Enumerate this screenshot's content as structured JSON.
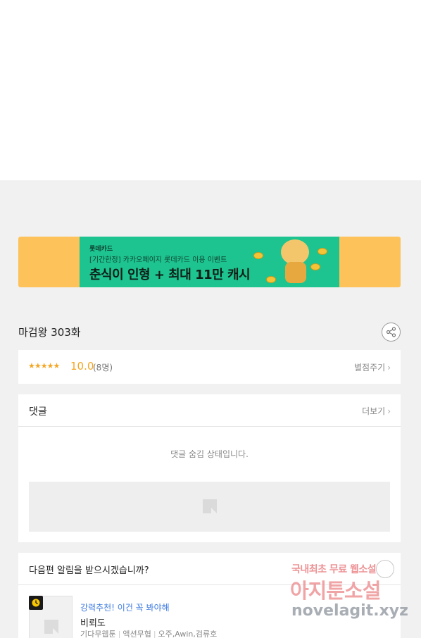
{
  "banner": {
    "brand": "롯데카드",
    "subtitle": "[기간한정] 카카오페이지 롯데카드 이용 이벤트",
    "headline": "춘식이 인형 + 최대 11만 캐시",
    "colors": {
      "outer": "#fdc35a",
      "inner": "#1ec48f"
    }
  },
  "episode": {
    "title": "마검왕 303화"
  },
  "rating": {
    "stars": "★★★★★",
    "score": "10.0",
    "count": "(8명)",
    "rate_label": "별점주기"
  },
  "comments": {
    "title": "댓글",
    "more_label": "더보기",
    "hidden_message": "댓글 숨김 상태입니다."
  },
  "notify": {
    "question": "다음편 알림을 받으시겠습니까?"
  },
  "recommendation": {
    "label": "강력추천! 이건 꼭 봐야해",
    "title": "비뢰도",
    "meta": [
      "기다무웹툰",
      "액션무협",
      "오주,Awin,검류호"
    ]
  },
  "watermark": {
    "line1": "국내최초 무료 웹소설",
    "line2": "아지툰소설",
    "line3": "novelagit.xyz"
  }
}
